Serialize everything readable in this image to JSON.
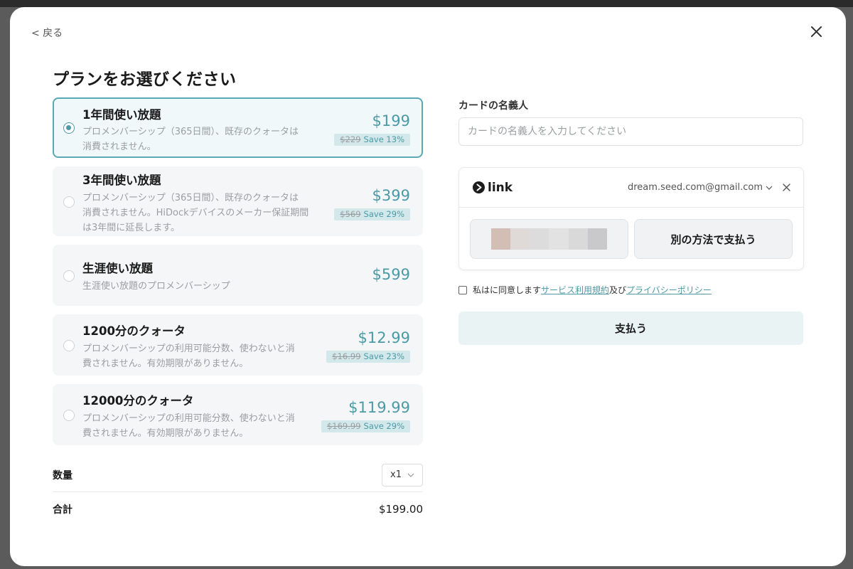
{
  "nav": {
    "back_label": "< 戻る"
  },
  "page": {
    "title": "プランをお選びください"
  },
  "plans": [
    {
      "name": "1年間使い放題",
      "desc_lines": [
        "プロメンバーシップ（365日間）、既存のクォータは",
        "消費されません。"
      ],
      "price": "$199",
      "old_price": "$229",
      "save": "Save 13%",
      "selected": true
    },
    {
      "name": "3年間使い放題",
      "desc_lines": [
        "プロメンバーシップ（365日間）、既存のクォータは",
        "消費されません。HiDockデバイスのメーカー保証期間",
        "は3年間に延長します。"
      ],
      "price": "$399",
      "old_price": "$569",
      "save": "Save 29%",
      "selected": false
    },
    {
      "name": "生涯使い放題",
      "desc_lines": [
        "生涯使い放題のプロメンバーシップ"
      ],
      "price": "$599",
      "old_price": null,
      "save": null,
      "selected": false
    },
    {
      "name": "1200分のクォータ",
      "desc_lines": [
        "プロメンバーシップの利用可能分数、使わないと消",
        "費されません。有効期限がありません。"
      ],
      "price": "$12.99",
      "old_price": "$16.99",
      "save": "Save 23%",
      "selected": false
    },
    {
      "name": "12000分のクォータ",
      "desc_lines": [
        "プロメンバーシップの利用可能分数、使わないと消",
        "費されません。有効期限がありません。"
      ],
      "price": "$119.99",
      "old_price": "$169.99",
      "save": "Save 29%",
      "selected": false
    }
  ],
  "quantity": {
    "label": "数量",
    "value": "x1"
  },
  "total": {
    "label": "合計",
    "value": "$199.00"
  },
  "cardholder": {
    "label": "カードの名義人",
    "placeholder": "カードの名義人を入力してください",
    "value": ""
  },
  "link": {
    "brand": "link",
    "email": "dream.seed.com@gmail.com",
    "alt_pay_label": "別の方法で支払う"
  },
  "agreement": {
    "prefix": "私はに同意します",
    "terms": "サービス利用規約",
    "conj": "及び",
    "privacy": "プライバシーポリシー"
  },
  "pay_button": "支払う",
  "colors": {
    "accent": "#4c9aa6",
    "selected_border": "#5aa8b3",
    "badge_bg": "#d3e8ea",
    "pay_button_bg": "#eaf3f4"
  }
}
